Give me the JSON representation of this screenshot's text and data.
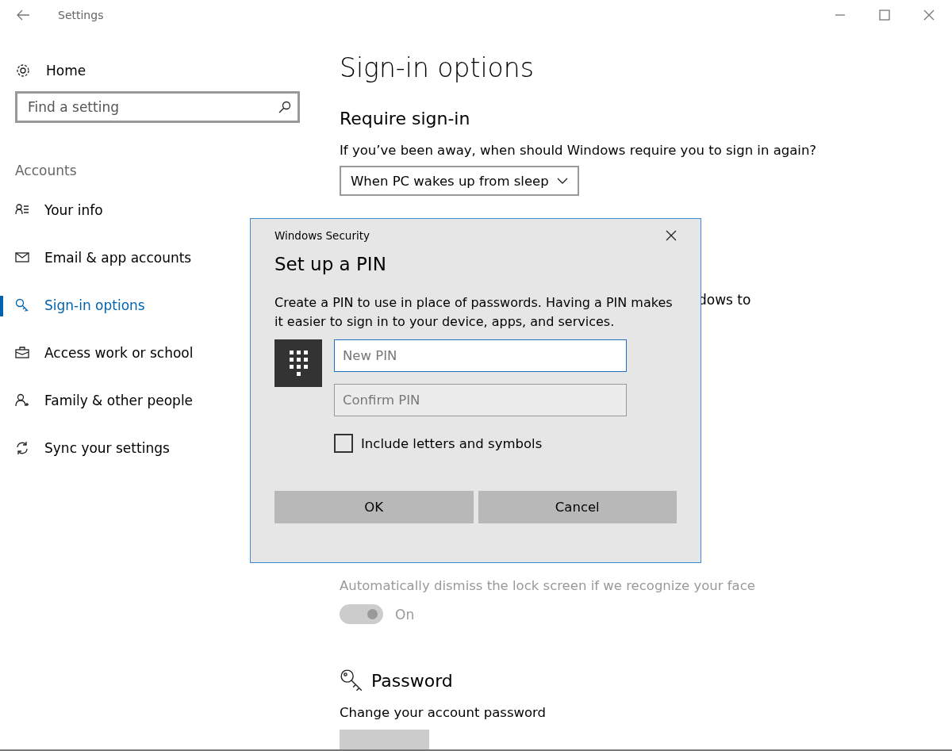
{
  "window": {
    "title": "Settings"
  },
  "sidebar": {
    "home": "Home",
    "search": {
      "placeholder": "Find a setting"
    },
    "section": "Accounts",
    "items": [
      {
        "label": "Your info",
        "kind": "profile",
        "selected": false
      },
      {
        "label": "Email & app accounts",
        "kind": "email",
        "selected": false
      },
      {
        "label": "Sign-in options",
        "kind": "signin",
        "selected": true
      },
      {
        "label": "Access work or school",
        "kind": "work",
        "selected": false
      },
      {
        "label": "Family & other people",
        "kind": "family",
        "selected": false
      },
      {
        "label": "Sync your settings",
        "kind": "sync",
        "selected": false
      }
    ]
  },
  "main": {
    "title": "Sign-in options",
    "section": "Require sign-in",
    "question": "If you’ve been away, when should Windows require you to sign in again?",
    "dropdown": {
      "value": "When PC wakes up from sleep"
    },
    "partly_hidden_text": "dows to",
    "face_setting": {
      "label": "Automatically dismiss the lock screen if we recognize your face",
      "toggle": {
        "on": true,
        "disabled": true,
        "label": "On"
      }
    },
    "password": {
      "heading": "Password",
      "description": "Change your account password",
      "button_shown": true
    }
  },
  "dialog": {
    "title": "Windows Security",
    "heading": "Set up a PIN",
    "description": "Create a PIN to use in place of passwords. Having a PIN makes it easier to sign in to your device, apps, and services.",
    "fields": [
      {
        "placeholder": "New PIN",
        "focused": true
      },
      {
        "placeholder": "Confirm PIN",
        "focused": false
      }
    ],
    "checkbox": {
      "label": "Include letters and symbols",
      "checked": false
    },
    "buttons": [
      "OK",
      "Cancel"
    ]
  }
}
